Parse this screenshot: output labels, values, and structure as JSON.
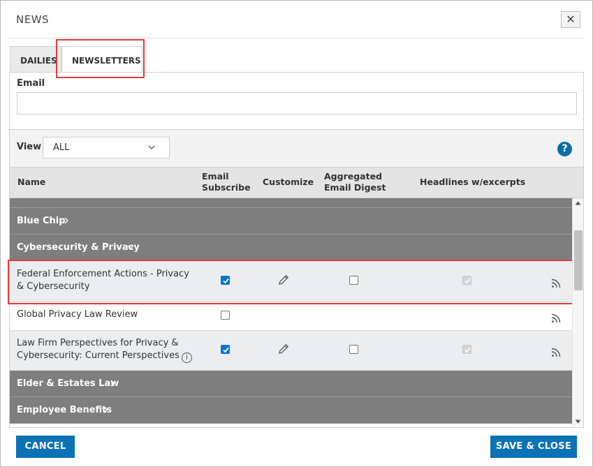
{
  "dialog": {
    "title": "NEWS",
    "close_label": "✕"
  },
  "tabs": [
    {
      "label": "DAILIES"
    },
    {
      "label": "NEWSLETTERS"
    }
  ],
  "email": {
    "label": "Email",
    "value": "",
    "placeholder": ""
  },
  "view": {
    "label": "View",
    "selected": "ALL"
  },
  "help_label": "?",
  "table": {
    "headers": {
      "name": "Name",
      "email_subscribe": [
        "Email",
        "Subscribe"
      ],
      "customize": "Customize",
      "aggregated": [
        "Aggregated",
        "Email Digest"
      ],
      "headlines": "Headlines w/excerpts"
    }
  },
  "list": {
    "categories": {
      "blue_chip": "Blue Chip",
      "cyber": "Cybersecurity & Privacy",
      "elder": "Elder & Estates Law",
      "employee": "Employee Benefits"
    },
    "items": [
      {
        "name_lines": [
          "Federal Enforcement Actions - Privacy",
          "& Cybersecurity"
        ],
        "email_subscribe": true,
        "aggregated": false,
        "headlines": true
      },
      {
        "name_lines": [
          "Global Privacy Law Review"
        ],
        "email_subscribe": false
      },
      {
        "name_lines": [
          "Law Firm Perspectives for Privacy &",
          "Cybersecurity: Current Perspectives"
        ],
        "email_subscribe": true,
        "aggregated": false,
        "headlines": true,
        "info_label": "i"
      }
    ]
  },
  "footer": {
    "cancel_label": "CANCEL",
    "save_label": "SAVE & CLOSE"
  },
  "colors": {
    "primary": "#0c72b6",
    "category_bg": "#7e7e7e",
    "highlight": "#e23b3b",
    "checkbox": "#0075d8"
  }
}
